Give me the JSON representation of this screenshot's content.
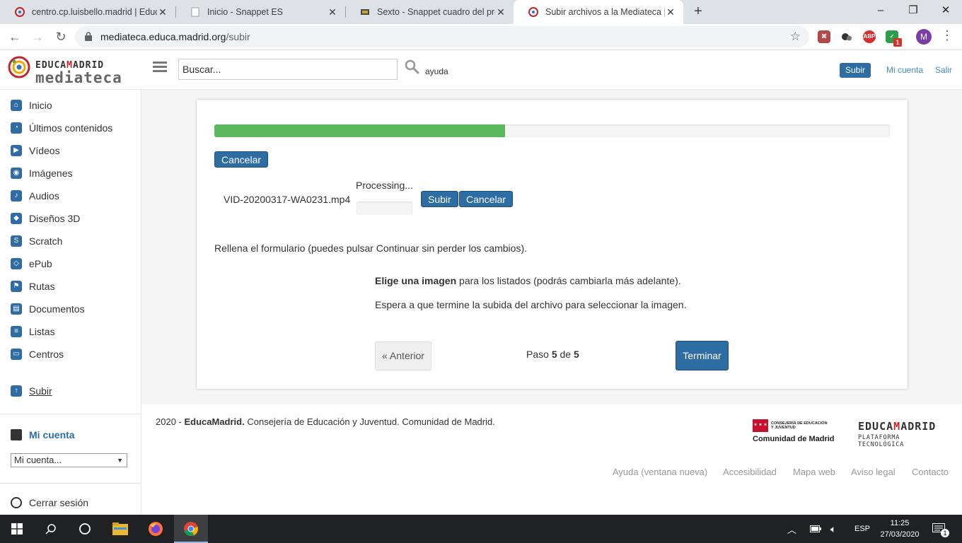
{
  "browser": {
    "tabs": [
      {
        "title": "centro.cp.luisbello.madrid | Educa",
        "active": false
      },
      {
        "title": "Inicio - Snappet ES",
        "active": false
      },
      {
        "title": "Sexto - Snappet cuadro del profe",
        "active": false
      },
      {
        "title": "Subir archivos a la Mediateca | M",
        "active": true
      }
    ],
    "url_host": "mediateca.educa.madrid.org",
    "url_path": "/subir",
    "profile_initial": "M",
    "extensions": [
      "pdf-icon",
      "bubbles-icon",
      "adblock-icon",
      "shield-icon"
    ],
    "extension_badge": "1",
    "adblock_label": "ABP"
  },
  "header": {
    "brand_line1_a": "EDUCA",
    "brand_line1_b": "M",
    "brand_line1_c": "ADRID",
    "brand_line2": "mediateca",
    "search_placeholder": "Buscar...",
    "help_label": "ayuda",
    "upload_button": "Subir",
    "my_account_link": "Mi cuenta",
    "logout_link": "Salir"
  },
  "sidebar": {
    "items": [
      {
        "label": "Inicio",
        "icon": "home-icon"
      },
      {
        "label": "Últimos contenidos",
        "icon": "clock-icon"
      },
      {
        "label": "Vídeos",
        "icon": "play-icon"
      },
      {
        "label": "Imágenes",
        "icon": "camera-icon"
      },
      {
        "label": "Audios",
        "icon": "speaker-icon"
      },
      {
        "label": "Diseños 3D",
        "icon": "cube-icon"
      },
      {
        "label": "Scratch",
        "icon": "scratch-icon"
      },
      {
        "label": "ePub",
        "icon": "epub-icon"
      },
      {
        "label": "Rutas",
        "icon": "flag-icon"
      },
      {
        "label": "Documentos",
        "icon": "document-icon"
      },
      {
        "label": "Listas",
        "icon": "list-icon"
      },
      {
        "label": "Centros",
        "icon": "folder-icon"
      }
    ],
    "upload_label": "Subir",
    "account_title": "Mi cuenta",
    "account_select_value": "Mi cuenta...",
    "logout_label": "Cerrar sesión"
  },
  "upload": {
    "progress_fraction": 0.43,
    "cancel_all_label": "Cancelar",
    "file_name": "VID-20200317-WA0231.mp4",
    "status_text": "Processing...",
    "file_upload_button": "Subir",
    "file_cancel_button": "Cancelar",
    "instructions": "Rellena el formulario (puedes pulsar Continuar sin perder los cambios).",
    "choose_bold": "Elige una imagen",
    "choose_rest": " para los listados (podrás cambiarla más adelante).",
    "wait_text": "Espera a que termine la subida del archivo para seleccionar la imagen.",
    "prev_button": "« Anterior",
    "step_prefix": "Paso ",
    "step_current": "5",
    "step_mid": " de ",
    "step_total": "5",
    "finish_button": "Terminar"
  },
  "footer": {
    "copy_year": "2020 - ",
    "copy_brand": "EducaMadrid.",
    "copy_text": " Consejería de Educación y Juventud. ",
    "copy_community": "Comunidad de Madrid",
    "copy_end": ".",
    "cm_small": "CONSEJERÍA DE EDUCACIÓN Y JUVENTUD",
    "cm_big": "Comunidad de Madrid",
    "em_logo_a": "EDUCA",
    "em_logo_b": "M",
    "em_logo_c": "ADRID",
    "em_logo_sub": "PLATAFORMA TECNOLÓGICA",
    "links": [
      "Ayuda (ventana nueva)",
      "Accesibilidad",
      "Mapa web",
      "Aviso legal",
      "Contacto"
    ]
  },
  "taskbar": {
    "language": "ESP",
    "time": "11:25",
    "date": "27/03/2020",
    "notification_count": "1"
  },
  "colors": {
    "primary": "#2e6da4",
    "progress": "#5cb85c",
    "brand_red": "#c0272d"
  }
}
